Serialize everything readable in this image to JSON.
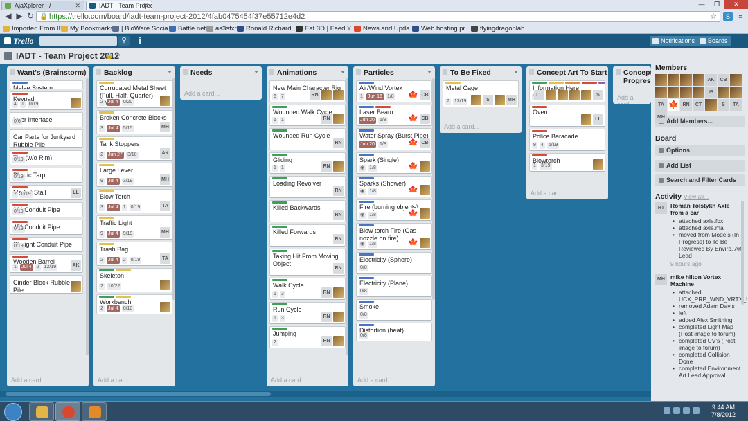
{
  "browser": {
    "tabs": [
      {
        "title": "AjaXplorer - /",
        "active": false,
        "color": "#6aa84f"
      },
      {
        "title": "IADT - Team Project",
        "active": true,
        "color": "#1a587f"
      }
    ],
    "url_scheme": "https://",
    "url_rest": "trello.com/board/iadt-team-project-2012/4fab0475454f37e55712e4d2",
    "bookmarks": [
      {
        "label": "Imported From IE",
        "color": "#e6b23a"
      },
      {
        "label": "My Bookmarks",
        "color": "#e6b23a"
      },
      {
        "label": "| BioWare Socia...",
        "color": "#5c6e8a"
      },
      {
        "label": "Battle.net",
        "color": "#3a6fb0"
      },
      {
        "label": "as3sfxr",
        "color": "#999999"
      },
      {
        "label": "Ronald Richard ...",
        "color": "#2c4f8a"
      },
      {
        "label": "Eat 3D | Feed Y...",
        "color": "#333333"
      },
      {
        "label": "News and Upda...",
        "color": "#d9482a"
      },
      {
        "label": "Web hosting pr...",
        "color": "#2c4f8a"
      },
      {
        "label": "flyingdragonlab...",
        "color": "#444444"
      }
    ]
  },
  "header": {
    "logo": "Trello",
    "notifications": "Notifications",
    "boards": "Boards",
    "accent": "#1a587f"
  },
  "board": {
    "title": "IADT - Team Project 2012",
    "background": "#23719f"
  },
  "lists": [
    {
      "name": "Want's (Brainstorm)",
      "add": "Add a card...",
      "cards": [
        {
          "title": "Melee System",
          "labels": [
            "#4a74c4"
          ],
          "badges": [],
          "members": []
        },
        {
          "title": "Keypad",
          "labels": [
            "#d64a3a"
          ],
          "badges": [
            "4",
            "1",
            "0/19"
          ],
          "members": [
            "img"
          ]
        },
        {
          "title": "User Interface",
          "labels": [],
          "badges": [
            "0/6"
          ],
          "members": []
        },
        {
          "title": "Car Parts for Junkyard Rubble Pile",
          "labels": [],
          "badges": [],
          "members": []
        },
        {
          "title": "Tire (w/o Rim)",
          "labels": [
            "#d64a3a"
          ],
          "badges": [
            "0/19"
          ],
          "members": []
        },
        {
          "title": "Plastic Tarp",
          "labels": [
            "#d64a3a"
          ],
          "badges": [
            "0/19"
          ],
          "members": []
        },
        {
          "title": "Market Stall",
          "labels": [
            "#d64a3a"
          ],
          "badges": [
            "2",
            "0/19"
          ],
          "members": [
            "LL"
          ]
        },
        {
          "title": "90° Conduit Pipe",
          "labels": [
            "#d64a3a"
          ],
          "badges": [
            "0/19"
          ],
          "members": []
        },
        {
          "title": "45° Conduit Pipe",
          "labels": [
            "#d64a3a"
          ],
          "badges": [
            "0/19"
          ],
          "members": []
        },
        {
          "title": "Straight Conduit Pipe",
          "labels": [
            "#d64a3a"
          ],
          "badges": [
            "0/19"
          ],
          "members": []
        },
        {
          "title": "Wooden Barrel",
          "labels": [
            "#d64a3a"
          ],
          "badges": [
            "1",
            "Jul 4",
            "2",
            "12/19"
          ],
          "members": [
            "AK"
          ]
        },
        {
          "title": "Cinder Block Rubble Pile",
          "labels": [],
          "badges": [],
          "members": [
            "img"
          ]
        }
      ]
    },
    {
      "name": "Backlog",
      "add": "Add a card...",
      "cards": [
        {
          "title": "Corrugated Metal Sheet (Full, Half, Quarter) DMG",
          "labels": [
            "#e3c14a"
          ],
          "badges": [
            "2",
            "Jul 4",
            "0/20"
          ],
          "members": [
            "img"
          ]
        },
        {
          "title": "Broken Concrete Blocks",
          "labels": [
            "#e3c14a"
          ],
          "badges": [
            "3",
            "Jul 4",
            "5/15"
          ],
          "members": [
            "MH"
          ]
        },
        {
          "title": "Tank Stoppers",
          "labels": [
            "#e3c14a"
          ],
          "badges": [
            "2",
            "Jun 27",
            "3/10"
          ],
          "members": [
            "AK"
          ]
        },
        {
          "title": "Large Lever",
          "labels": [
            "#e3c14a"
          ],
          "badges": [
            "9",
            "Jul 4",
            "3/19"
          ],
          "members": [
            "MH"
          ]
        },
        {
          "title": "Blow Torch",
          "labels": [
            "#e3c14a"
          ],
          "badges": [
            "3",
            "Jul 4",
            "1",
            "0/19"
          ],
          "members": [
            "TA"
          ]
        },
        {
          "title": "Traffic Light",
          "labels": [
            "#e3c14a"
          ],
          "badges": [
            "9",
            "Jul 4",
            "9/19"
          ],
          "members": [
            "MH"
          ]
        },
        {
          "title": "Trash Bag",
          "labels": [
            "#e3c14a"
          ],
          "badges": [
            "2",
            "Jul 4",
            "2",
            "0/19"
          ],
          "members": [
            "TA"
          ]
        },
        {
          "title": "Skeleton",
          "labels": [
            "#3fa05a",
            "#e3c14a"
          ],
          "badges": [
            "2",
            "10/22"
          ],
          "members": [
            "img"
          ]
        },
        {
          "title": "Workbench",
          "labels": [
            "#3fa05a",
            "#e3c14a"
          ],
          "badges": [
            "2",
            "Jul 4",
            "0/10"
          ],
          "members": [
            "img"
          ]
        }
      ]
    },
    {
      "name": "Needs",
      "add": "Add a card...",
      "cards": []
    },
    {
      "name": "Animations",
      "add": "Add a card...",
      "cards": [
        {
          "title": "New Main Character Rig",
          "labels": [],
          "badges": [
            "6",
            "7"
          ],
          "members": [
            "RN",
            "img",
            "img"
          ]
        },
        {
          "title": "Wounded Walk Cycle",
          "labels": [
            "#3fa05a"
          ],
          "badges": [
            "1",
            "1"
          ],
          "members": [
            "RN",
            "img"
          ]
        },
        {
          "title": "Wounded Run Cycle",
          "labels": [
            "#3fa05a"
          ],
          "badges": [],
          "members": [
            "RN"
          ]
        },
        {
          "title": "Gliding",
          "labels": [
            "#3fa05a"
          ],
          "badges": [
            "1",
            "1"
          ],
          "members": [
            "RN",
            "img"
          ]
        },
        {
          "title": "Loading Revolver",
          "labels": [
            "#3fa05a"
          ],
          "badges": [],
          "members": [
            "RN"
          ]
        },
        {
          "title": "Killed Backwards",
          "labels": [
            "#3fa05a"
          ],
          "badges": [],
          "members": [
            "RN"
          ]
        },
        {
          "title": "Killed Forwards",
          "labels": [
            "#3fa05a"
          ],
          "badges": [],
          "members": [
            "RN"
          ]
        },
        {
          "title": "Taking Hit From Moving Object",
          "labels": [
            "#3fa05a"
          ],
          "badges": [],
          "members": [
            "RN"
          ]
        },
        {
          "title": "Walk Cycle",
          "labels": [
            "#3fa05a"
          ],
          "badges": [
            "1",
            "3"
          ],
          "members": [
            "RN",
            "img"
          ]
        },
        {
          "title": "Run Cycle",
          "labels": [
            "#3fa05a"
          ],
          "badges": [
            "1",
            "3"
          ],
          "members": [
            "RN",
            "img"
          ]
        },
        {
          "title": "Jumping",
          "labels": [
            "#3fa05a"
          ],
          "badges": [
            "2"
          ],
          "members": [
            "RN",
            "img"
          ]
        }
      ]
    },
    {
      "name": "Particles",
      "add": "Add a card...",
      "cards": [
        {
          "title": "Air/Wind Vortex",
          "labels": [
            "#4a74c4"
          ],
          "badges": [
            "1",
            "Jun 16",
            "1/8"
          ],
          "members": [
            "flag",
            "CB"
          ]
        },
        {
          "title": "Laser Beam",
          "labels": [
            "#4a74c4",
            "#d64a3a"
          ],
          "badges": [
            "Jun 20",
            "1/8"
          ],
          "members": [
            "flag",
            "CB"
          ]
        },
        {
          "title": "Water Spray (Burst Pipe)",
          "labels": [
            "#4a74c4"
          ],
          "badges": [
            "Jun 20",
            "1/8"
          ],
          "members": [
            "flag",
            "CB"
          ]
        },
        {
          "title": "Spark (Single)",
          "labels": [
            "#4a74c4"
          ],
          "badges": [
            "◉",
            "1/8"
          ],
          "members": [
            "flag",
            "img"
          ]
        },
        {
          "title": "Sparks (Shower)",
          "labels": [
            "#4a74c4"
          ],
          "badges": [
            "◉",
            "1/8"
          ],
          "members": [
            "flag",
            "img"
          ]
        },
        {
          "title": "Fire (burning objects)",
          "labels": [
            "#4a74c4"
          ],
          "badges": [
            "◉",
            "1/8"
          ],
          "members": [
            "flag",
            "img"
          ]
        },
        {
          "title": "Blow torch Fire (Gas nozzle on fire)",
          "labels": [
            "#4a74c4"
          ],
          "badges": [
            "◉",
            "1/8"
          ],
          "members": [
            "flag",
            "img"
          ]
        },
        {
          "title": "Electricity (Sphere)",
          "labels": [
            "#4a74c4"
          ],
          "badges": [
            "0/8"
          ],
          "members": []
        },
        {
          "title": "Electricity (Plane)",
          "labels": [
            "#4a74c4"
          ],
          "badges": [
            "0/8"
          ],
          "members": []
        },
        {
          "title": "Smoke",
          "labels": [
            "#4a74c4"
          ],
          "badges": [
            "0/8"
          ],
          "members": []
        },
        {
          "title": "Distortion (heat)",
          "labels": [
            "#4a74c4"
          ],
          "badges": [
            "0/8"
          ],
          "members": []
        }
      ]
    },
    {
      "name": "To Be Fixed",
      "add": "Add a card...",
      "cards": [
        {
          "title": "Metal Cage",
          "labels": [
            "#e3c14a"
          ],
          "badges": [
            "7",
            "13/19"
          ],
          "members": [
            "img",
            "S",
            "img",
            "MH"
          ]
        }
      ]
    },
    {
      "name": "Concept Art To Start",
      "add": "Add a card...",
      "cards": [
        {
          "title": "Information Here",
          "labels": [
            "#3fa05a",
            "#e3c14a",
            "#e08a3a",
            "#d64a3a",
            "#8a5fb0",
            "#4a74c4"
          ],
          "badges": [
            "✎"
          ],
          "members": [
            "LL",
            "img",
            "img",
            "img",
            "img",
            "S"
          ]
        },
        {
          "title": "Oven",
          "labels": [
            "#d64a3a"
          ],
          "badges": [],
          "members": [
            "img",
            "LL"
          ]
        },
        {
          "title": "Police Baracade",
          "labels": [
            "#d64a3a"
          ],
          "badges": [
            "9",
            "4",
            "6/19"
          ],
          "members": []
        },
        {
          "title": "Blowtorch",
          "labels": [
            "#d64a3a"
          ],
          "badges": [
            "1",
            "3/19"
          ],
          "members": [
            "img"
          ]
        }
      ]
    },
    {
      "name": "Concept Progress",
      "add": "Add a card...",
      "cards": []
    }
  ],
  "sidebar": {
    "members_title": "Members",
    "members": [
      "img",
      "img",
      "img",
      "img",
      "AK",
      "CB",
      "img",
      "img",
      "img",
      "img",
      "img",
      "IB",
      "img",
      "img",
      "TA",
      "flag",
      "RN",
      "CT",
      "img",
      "S",
      "TA",
      "MH"
    ],
    "add_members": "Add Members...",
    "board_title": "Board",
    "options": "Options",
    "add_list": "Add List",
    "search_filter": "Search and Filter Cards",
    "activity_title": "Activity",
    "view_all": "View all...",
    "activity": [
      {
        "avatar": "RT",
        "who": "Roman Tolstykh Axle from a car",
        "items": [
          "attached axle.fbx",
          "attached axle.ma",
          "moved from Models (In Progress) to To Be Reviewed By Enviro. Art Lead"
        ],
        "time": "9 hours ago"
      },
      {
        "avatar": "MH",
        "who": "mike hilton Vortex Machine",
        "items": [
          "attached UCX_PRP_WND_VRTX_Uved.mb",
          "removed Adam Davis",
          "left",
          "added Alex Smithing",
          "completed Light Map (Post image to forum)",
          "completed UV's (Post image to forum)",
          "completed Collision Done",
          "completed Environment Art Lead Approval"
        ],
        "time": ""
      }
    ]
  },
  "taskbar": {
    "time": "9:44 AM",
    "date": "7/8/2012"
  }
}
